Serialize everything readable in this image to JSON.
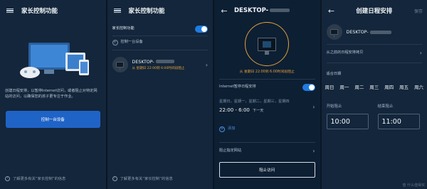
{
  "panel1": {
    "title": "家长控制功能",
    "description": "创建日程安排，以暂停Internet访问，或者阻止对特定网站的访问，以确保您的孩子更专注于作业。",
    "button_label": "控制一台设备",
    "info_text": "了解更多有关“家长控制”的信息"
  },
  "panel2": {
    "title": "家长控制功能",
    "toggle_label": "家长控制功能",
    "add_label": "控制一台设备",
    "device_name": "DESKTOP-",
    "device_status": "从 星期日 22:00到 6:00时间段阻止",
    "info_text": "了解更多有关“家长控制”的信息"
  },
  "panel3": {
    "title": "DESKTOP-",
    "status": "从 星期日 22:00到 6:00时间段阻止",
    "schedule_label": "Internet暂停日程安排",
    "days_text": "星期日，星期一，星期二，星期三，星期四",
    "time_range": "22:00 - 6:00",
    "next_day": "下一天",
    "add_label": "添加",
    "block_sites_label": "阻止指定网站",
    "block_button": "阻止访问"
  },
  "panel4": {
    "title": "创建日程安排",
    "save_label": "保存",
    "device_name": "DESKTOP-",
    "from_schedule": "从之前的日程安排拷贝",
    "repeat_label": "适合日期",
    "days": [
      "周日",
      "周一",
      "周二",
      "周三",
      "周四",
      "周五",
      "周六"
    ],
    "start_label": "开始阻止",
    "end_label": "结束阻止",
    "start_time": "10:00",
    "end_time": "11:00"
  },
  "watermark": "值 什么值得买",
  "colors": {
    "accent_blue": "#1f63c7",
    "warning_orange": "#e5a23c",
    "background": "#13263b"
  }
}
